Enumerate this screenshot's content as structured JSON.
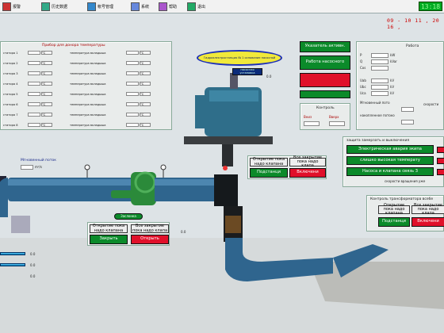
{
  "toolbar": {
    "items": [
      {
        "label": "报警",
        "icon": "alarm-icon"
      },
      {
        "label": "历史数据",
        "icon": "history-data-icon"
      },
      {
        "label": "帐号管理",
        "icon": "account-management-icon"
      },
      {
        "label": "系统",
        "icon": "system-icon"
      },
      {
        "label": "帮助",
        "icon": "help-icon"
      },
      {
        "label": "退出",
        "icon": "exit-icon"
      }
    ],
    "clock": "13:18"
  },
  "datetime": "09 - 10 11 , 20 16 ,",
  "temp_panel": {
    "title": "Прибор для донора температуры",
    "rows": [
      {
        "left": "статора 1",
        "unit": "°C",
        "right": "температура вкладыша",
        "unit2": "°C"
      },
      {
        "left": "статора 2",
        "unit": "°C",
        "right": "температура вкладыша",
        "unit2": "°C"
      },
      {
        "left": "статора 3",
        "unit": "°C",
        "right": "температура вкладыша",
        "unit2": "°C"
      },
      {
        "left": "статора 4",
        "unit": "°C",
        "right": "температура вкладыша",
        "unit2": "°C"
      },
      {
        "left": "статора 5",
        "unit": "°C",
        "right": "температура вкладыша",
        "unit2": "°C"
      },
      {
        "left": "статора 6",
        "unit": "°C",
        "right": "температура вкладыша",
        "unit2": "°C"
      },
      {
        "left": "статора 7",
        "unit": "°C",
        "right": "температура вкладыша",
        "unit2": "°C"
      },
      {
        "left": "статора 8",
        "unit": "°C",
        "right": "температура вкладыша",
        "unit2": "°C"
      }
    ]
  },
  "station_banner": "Гидроэлектростанция № 1 основание насосной",
  "turbine_label": "Насосная установка",
  "flow_label": "Мгновенный поток",
  "flow_value": "m³/s",
  "right_col": {
    "indicator": "Указатель активн.",
    "pump_work": "Работа насосного",
    "red_btn": "",
    "green_btn": "",
    "control_title": "Контроль",
    "control_down": "Вниз",
    "control_up": "Вверх"
  },
  "work_panel": {
    "title": "Работа",
    "labels": [
      "P",
      "Q",
      "Cos",
      "Uab",
      "Ubc",
      "Uca"
    ],
    "units": [
      "kW",
      "kVar",
      "",
      "kV",
      "kV",
      "kV"
    ],
    "instant_flow": "Мгновенный пото",
    "acc_flow": "накопленное потоко",
    "speed_label": "скорости"
  },
  "alarm_panel": {
    "title": "защита замерзать и выключения",
    "items": [
      "Электрическая авария экипа",
      "слишко высокая температу",
      "Насоса и клапана связь 3"
    ],
    "note": "скорости вращения уже"
  },
  "valve_mid": {
    "open_state": "Открытие пока надо клапана",
    "close_state": "Все закрытие пока надо клапа",
    "sub_btn": "Подстанци",
    "on_btn": "Включени"
  },
  "valve_left": {
    "tag": "Заслонка",
    "open_state": "Открытие пока надо клапана",
    "close_state": "Все закрытие пока надо клапа",
    "close_btn": "Закрыть",
    "open_btn": "Открыть"
  },
  "transformer_panel": {
    "title": "Контроль трансформатора всебе",
    "open_state": "Открытие пока надо клапана",
    "close_state": "Все закрытие пока надо клапа",
    "sub_btn": "Подстанци",
    "on_btn": "Включени"
  },
  "small_tags": [
    "0.0",
    "0.0",
    "0.0",
    "0.0",
    "0.0"
  ],
  "colors": {
    "green": "#0b8a2a",
    "red": "#e0102a",
    "pipe": "#2d5f86",
    "navy": "#0b2b7a"
  }
}
